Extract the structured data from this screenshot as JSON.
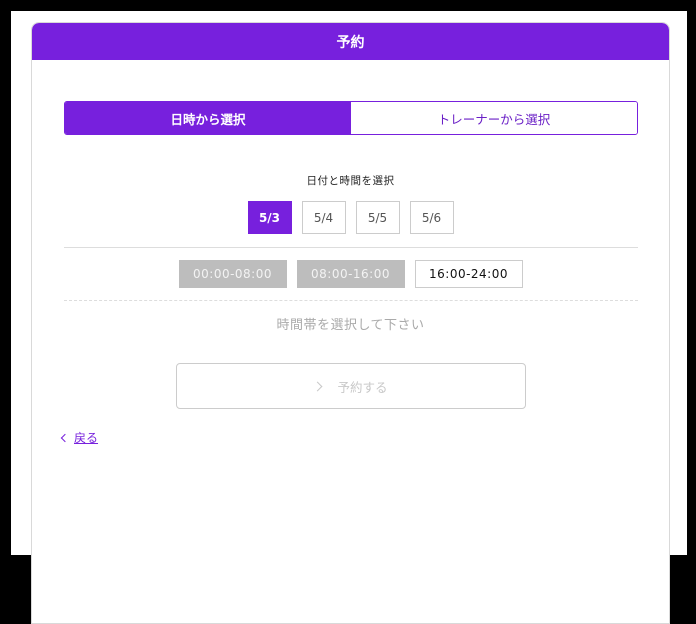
{
  "header": {
    "title": "予約"
  },
  "mode_tabs": [
    {
      "label": "日時から選択",
      "active": true
    },
    {
      "label": "トレーナーから選択",
      "active": false
    }
  ],
  "date_section": {
    "title": "日付と時間を選択"
  },
  "dates": [
    {
      "label": "5/3",
      "selected": true
    },
    {
      "label": "5/4",
      "selected": false
    },
    {
      "label": "5/5",
      "selected": false
    },
    {
      "label": "5/6",
      "selected": false
    }
  ],
  "time_slots": [
    {
      "label": "00:00-08:00",
      "state": "disabled"
    },
    {
      "label": "08:00-16:00",
      "state": "disabled"
    },
    {
      "label": "16:00-24:00",
      "state": "available"
    }
  ],
  "hint": "時間帯を選択して下さい",
  "reserve_button": {
    "label": "予約する"
  },
  "back_link": {
    "label": "戻る"
  },
  "colors": {
    "accent": "#7720dd",
    "disabled": "#bdbdbd"
  }
}
